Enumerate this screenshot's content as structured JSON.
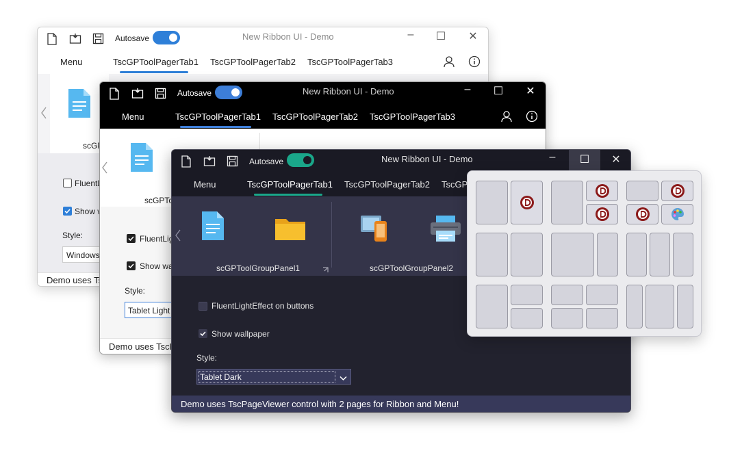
{
  "window": {
    "title": "New Ribbon UI - Demo",
    "autosave_label": "Autosave",
    "menu_label": "Menu",
    "tabs": [
      "TscGPToolPagerTab1",
      "TscGPToolPagerTab2",
      "TscGPToolPagerTab3"
    ],
    "group_panels": [
      "scGPToolGroupPanel1",
      "scGPToolGroupPanel2"
    ],
    "fluent_label": "FluentLightEffect on buttons",
    "wallpaper_label": "Show wallpaper",
    "style_label": "Style:",
    "status_text": "Demo uses TscPageViewer control with 2 pages for Ribbon and Menu!"
  },
  "light_window": {
    "group_label_partial": "scGP",
    "fluent_partial": "FluentLi",
    "wallpaper_partial": "Show w",
    "style_value": "Windows",
    "status_partial": "Demo uses Tsc"
  },
  "black_window": {
    "group_label_partial": "scGPTo",
    "fluent_partial": "FluentLigh",
    "wallpaper_partial": "Show wall",
    "style_value": "Tablet Light",
    "status_partial": "Demo uses TscP"
  },
  "dark_window": {
    "tab3_partial": "TscGP",
    "style_value": "Tablet Dark",
    "fluent_checked": false,
    "wallpaper_checked": true
  },
  "colors": {
    "light_accent": "#2e7fd8",
    "black_accent": "#3d7ed8",
    "dark_accent": "#1aa78a",
    "dark_bg": "#22222e",
    "dark_ribbon": "#343449",
    "dark_status": "#37395a"
  },
  "icons": [
    "new-file-icon",
    "open-folder-icon",
    "save-icon",
    "user-icon",
    "info-icon",
    "document-icon",
    "folder-icon",
    "devices-icon",
    "printer-icon",
    "chevron-left-icon",
    "chevron-down-icon",
    "minimize-icon",
    "maximize-icon",
    "close-icon",
    "delphi-logo-icon",
    "paint-palette-icon"
  ]
}
